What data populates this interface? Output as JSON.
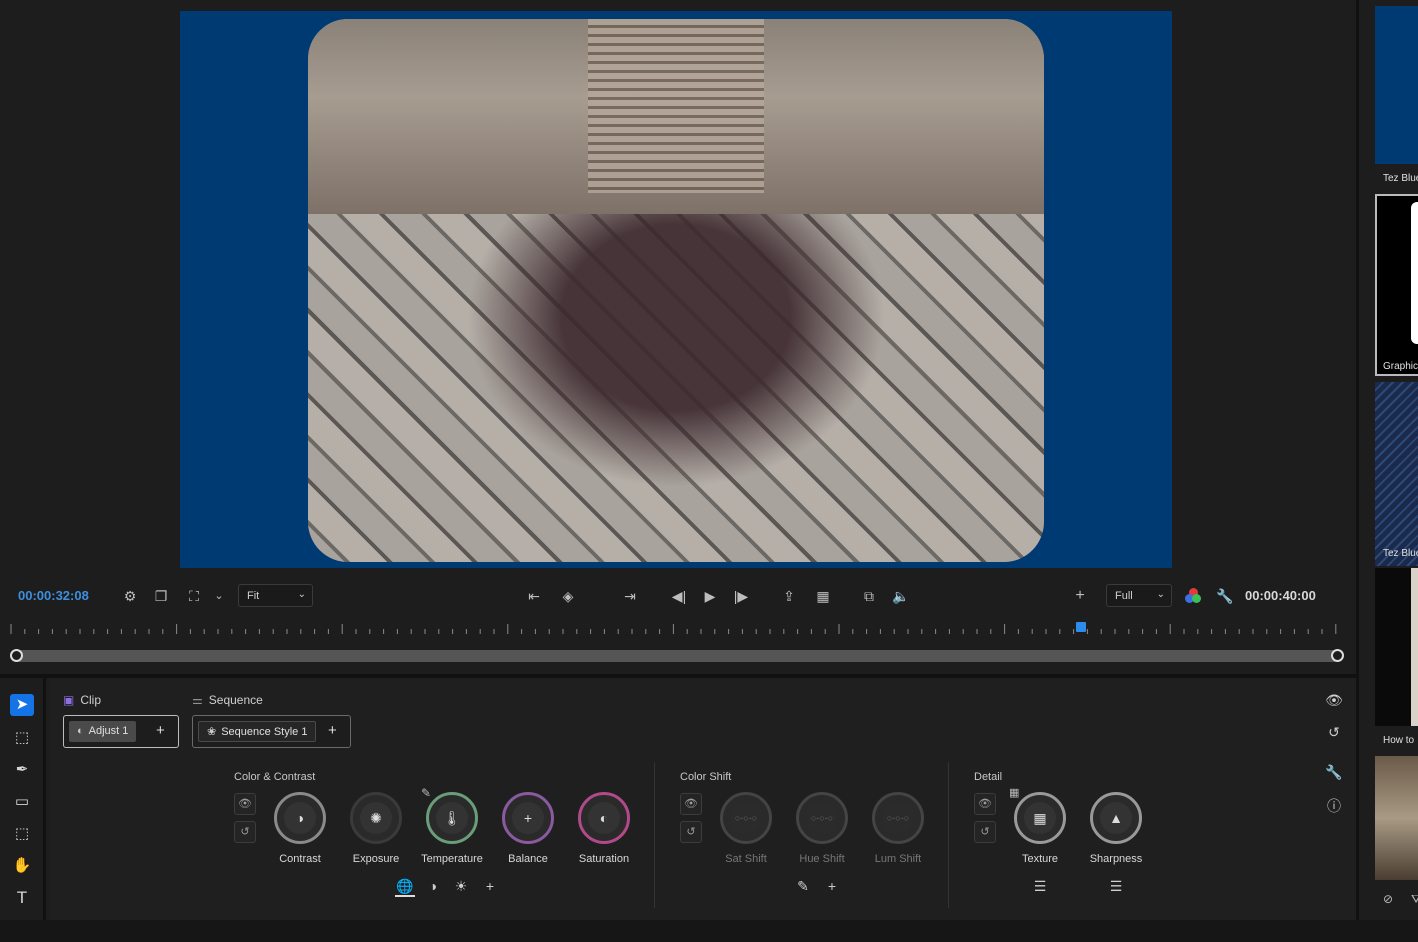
{
  "monitor": {
    "current_time": "00:00:32:08",
    "duration": "00:00:40:00",
    "fit_dropdown": "Fit",
    "quality_dropdown": "Full"
  },
  "panel": {
    "tabs": {
      "clip": "Clip",
      "sequence": "Sequence"
    },
    "chips": {
      "adjust": "Adjust 1",
      "sequence_style": "Sequence Style 1"
    },
    "sections": {
      "color_contrast": {
        "title": "Color & Contrast",
        "dials": [
          "Contrast",
          "Exposure",
          "Temperature",
          "Balance",
          "Saturation"
        ]
      },
      "color_shift": {
        "title": "Color Shift",
        "dials": [
          "Sat Shift",
          "Hue Shift",
          "Lum Shift"
        ]
      },
      "detail": {
        "title": "Detail",
        "dials": [
          "Texture",
          "Sharpness"
        ]
      }
    }
  },
  "sidebar": {
    "items": [
      "Tez Blue",
      "Graphic",
      "Tez Blue",
      "How to"
    ]
  },
  "colors": {
    "accent": "#1473e6",
    "frame_bg": "#003a72",
    "timecode": "#3d8fe0"
  }
}
